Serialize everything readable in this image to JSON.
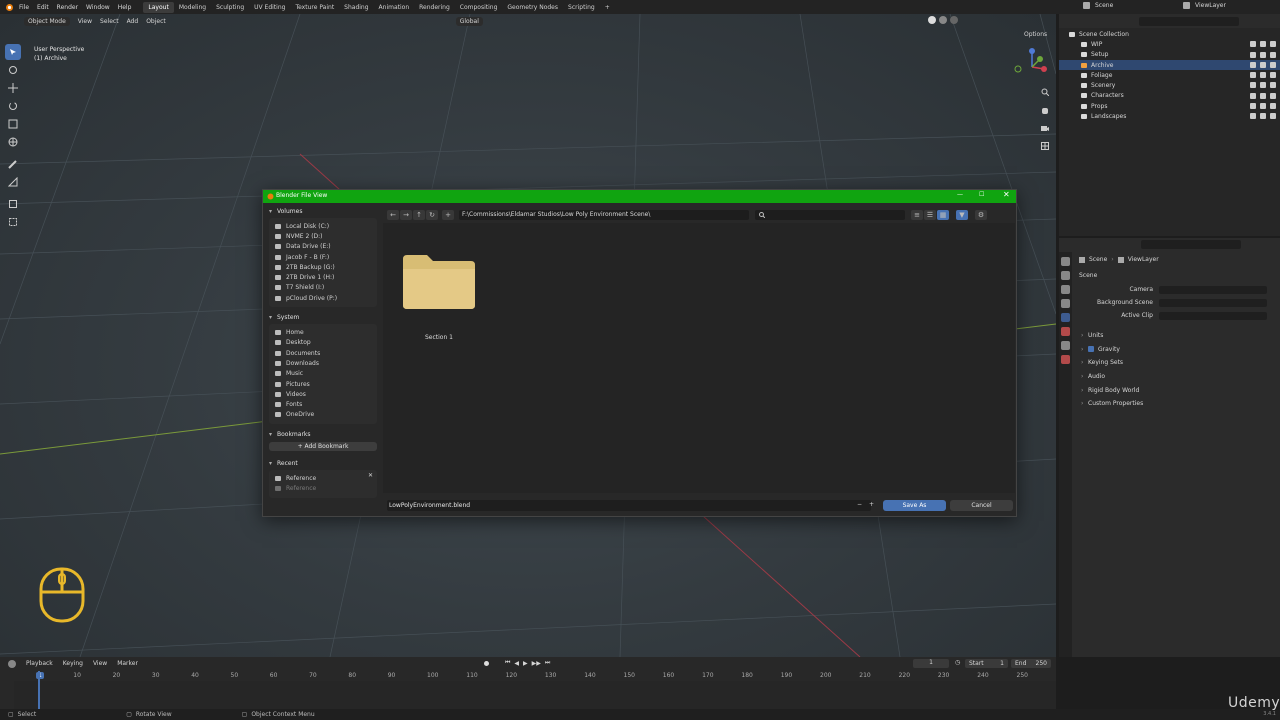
{
  "topbar": {
    "menus": [
      "File",
      "Edit",
      "Render",
      "Window",
      "Help"
    ],
    "workspaces": [
      "Layout",
      "Modeling",
      "Sculpting",
      "UV Editing",
      "Texture Paint",
      "Shading",
      "Animation",
      "Rendering",
      "Compositing",
      "Geometry Nodes",
      "Scripting",
      "+"
    ],
    "active_workspace": "Layout",
    "scene": "Scene",
    "view_layer": "ViewLayer"
  },
  "viewport": {
    "mode": "Object Mode",
    "menus": [
      "View",
      "Select",
      "Add",
      "Object"
    ],
    "transform": "Global",
    "perspective": "User Perspective",
    "collection": "(1) Archive",
    "options_label": "Options"
  },
  "dialog": {
    "title": "Blender File View",
    "path": "F:\\Commissions\\Eldamar Studios\\Low Poly Environment Scene\\",
    "sections": {
      "volumes": {
        "label": "Volumes",
        "items": [
          "Local Disk (C:)",
          "NVME 2 (D:)",
          "Data Drive (E:)",
          "Jacob F - B (F:)",
          "2TB Backup  (G:)",
          "2TB Drive 1 (H:)",
          "T7 Shield (I:)",
          "pCloud Drive (P:)"
        ]
      },
      "system": {
        "label": "System",
        "items": [
          "Home",
          "Desktop",
          "Documents",
          "Downloads",
          "Music",
          "Pictures",
          "Videos",
          "Fonts",
          "OneDrive"
        ]
      },
      "bookmarks": {
        "label": "Bookmarks",
        "add_label": "Add Bookmark"
      },
      "recent": {
        "label": "Recent",
        "items": [
          "Reference",
          "Reference"
        ]
      }
    },
    "folder": "Section 1",
    "filename": "LowPolyEnvironment.blend",
    "save_label": "Save As",
    "cancel_label": "Cancel"
  },
  "outliner": {
    "root": "Scene Collection",
    "items": [
      "WIP",
      "Setup",
      "Archive",
      "Foliage",
      "Scenery",
      "Characters",
      "Props",
      "Landscapes"
    ],
    "selected": "Archive"
  },
  "properties": {
    "breadcrumb_scene": "Scene",
    "breadcrumb_layer": "ViewLayer",
    "panel": "Scene",
    "fields": [
      "Camera",
      "Background Scene",
      "Active Clip"
    ],
    "subpanels": [
      "Units",
      "Gravity",
      "Keying Sets",
      "Audio",
      "Rigid Body World",
      "Custom Properties"
    ]
  },
  "timeline": {
    "menus": [
      "Playback",
      "Keying",
      "View",
      "Marker"
    ],
    "current_frame": "1",
    "start_label": "Start",
    "start": "1",
    "end_label": "End",
    "end": "250",
    "ruler": [
      "1",
      "10",
      "20",
      "30",
      "40",
      "50",
      "60",
      "70",
      "80",
      "90",
      "100",
      "110",
      "120",
      "130",
      "140",
      "150",
      "160",
      "170",
      "180",
      "190",
      "200",
      "210",
      "220",
      "230",
      "240",
      "250"
    ]
  },
  "statusbar": {
    "items": [
      "Select",
      "Rotate View",
      "Object Context Menu"
    ],
    "version": "3.4.1"
  },
  "watermark": "Udemy",
  "colors": {
    "accent": "#4772b3",
    "title_bar": "#10a410",
    "folder": "#e0c27a"
  }
}
